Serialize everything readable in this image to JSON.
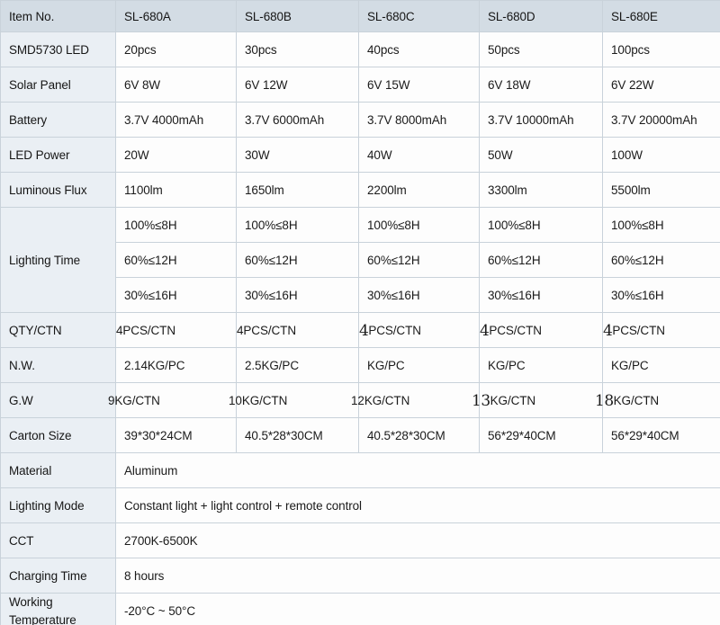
{
  "table": {
    "header": {
      "label": "Item No.",
      "models": [
        "SL-680A",
        "SL-680B",
        "SL-680C",
        "SL-680D",
        "SL-680E"
      ]
    },
    "rows": [
      {
        "label": "SMD5730 LED",
        "values": [
          "20pcs",
          "30pcs",
          "40pcs",
          "50pcs",
          "100pcs"
        ]
      },
      {
        "label": "Solar Panel",
        "values": [
          "6V 8W",
          "6V 12W",
          "6V 15W",
          "6V 18W",
          "6V 22W"
        ]
      },
      {
        "label": "Battery",
        "values": [
          "3.7V 4000mAh",
          "3.7V 6000mAh",
          "3.7V 8000mAh",
          "3.7V 10000mAh",
          "3.7V 20000mAh"
        ]
      },
      {
        "label": "LED Power",
        "values": [
          "20W",
          "30W",
          "40W",
          "50W",
          "100W"
        ]
      },
      {
        "label": "Luminous Flux",
        "values": [
          "1100lm",
          "1650lm",
          "2200lm",
          "3300lm",
          "5500lm"
        ]
      }
    ],
    "lighting_time": {
      "label": "Lighting Time",
      "lines": [
        {
          "values": [
            "100%≤8H",
            "100%≤8H",
            "100%≤8H",
            "100%≤8H",
            "100%≤8H"
          ]
        },
        {
          "values": [
            "60%≤12H",
            "60%≤12H",
            "60%≤12H",
            "60%≤12H",
            "60%≤12H"
          ]
        },
        {
          "values": [
            "30%≤16H",
            "30%≤16H",
            "30%≤16H",
            "30%≤16H",
            "30%≤16H"
          ]
        }
      ]
    },
    "qty": {
      "label": "QTY/CTN",
      "values": [
        {
          "lead": "",
          "rest": "4PCS/CTN"
        },
        {
          "lead": "",
          "rest": "4PCS/CTN"
        },
        {
          "lead": "4",
          "rest": "PCS/CTN"
        },
        {
          "lead": "4",
          "rest": "PCS/CTN"
        },
        {
          "lead": "4",
          "rest": "PCS/CTN"
        }
      ]
    },
    "nw": {
      "label": "N.W.",
      "values": [
        "2.14KG/PC",
        "2.5KG/PC",
        "KG/PC",
        "KG/PC",
        "KG/PC"
      ]
    },
    "gw": {
      "label": "G.W",
      "values": [
        {
          "lead": "",
          "rest": "9KG/CTN"
        },
        {
          "lead": "",
          "rest": "10KG/CTN"
        },
        {
          "lead": "",
          "rest": "12KG/CTN"
        },
        {
          "lead": "13",
          "rest": "KG/CTN"
        },
        {
          "lead": "18",
          "rest": "KG/CTN"
        }
      ]
    },
    "carton": {
      "label": "Carton Size",
      "values": [
        "39*30*24CM",
        "40.5*28*30CM",
        "40.5*28*30CM",
        "56*29*40CM",
        "56*29*40CM"
      ]
    },
    "wide_rows": [
      {
        "label": "Material",
        "value": "Aluminum"
      },
      {
        "label": "Lighting Mode",
        "value": "Constant light + light control + remote control"
      },
      {
        "label": "CCT",
        "value": "2700K-6500K"
      },
      {
        "label": "Charging Time",
        "value": "8 hours"
      },
      {
        "label": "Working Temperature",
        "label_line1": "Working",
        "label_line2": "Temperature",
        "value": "-20°C ~ 50°C"
      }
    ]
  },
  "colors": {
    "header_bg": "#d3dce4",
    "label_bg": "#eaeff4",
    "value_bg": "#fdfdfd",
    "border": "#c9d2da",
    "text": "#161616"
  }
}
